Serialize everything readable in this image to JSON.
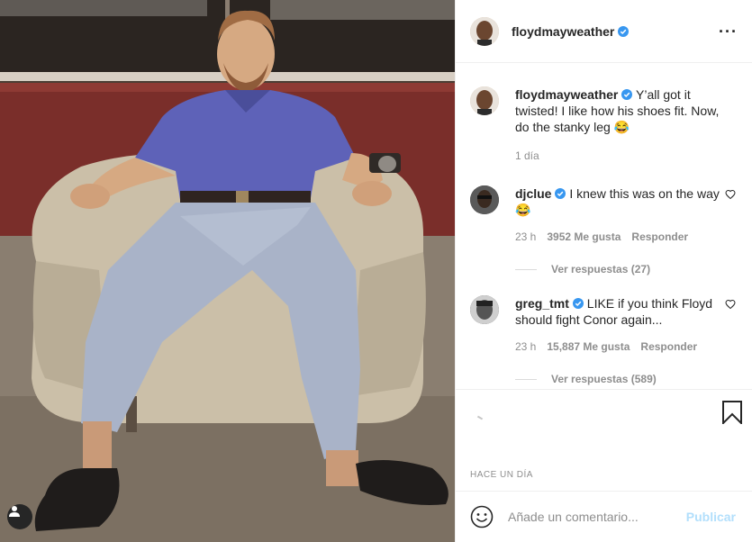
{
  "post": {
    "author": "floydmayweather",
    "timestamp": "HACE UN DÍA"
  },
  "caption": {
    "username": "floydmayweather",
    "text": "Y’all got it twisted! I like how his shoes fit. Now, do the stanky leg 😂",
    "age": "1 día"
  },
  "comments": [
    {
      "username": "djclue",
      "text": "I knew this was on the way 😂",
      "age": "23 h",
      "likes": "3952 Me gusta",
      "reply_label": "Responder",
      "view_replies": "Ver respuestas (27)"
    },
    {
      "username": "greg_tmt",
      "text": "LIKE if you think Floyd should fight Conor again...",
      "age": "23 h",
      "likes": "15,887 Me gusta",
      "reply_label": "Responder",
      "view_replies": "Ver respuestas (589)"
    }
  ],
  "composer": {
    "placeholder": "Añade un comentario...",
    "post_label": "Publicar"
  },
  "icons": {
    "verified": "verified-badge-icon",
    "more": "more-options-icon",
    "heart": "heart-icon",
    "bookmark": "bookmark-icon",
    "emoji": "emoji-icon",
    "user_tag": "user-tag-icon"
  },
  "colors": {
    "verified_blue": "#3897f0",
    "post_button_disabled": "#b2dffc",
    "muted_text": "#8e8e8e"
  }
}
